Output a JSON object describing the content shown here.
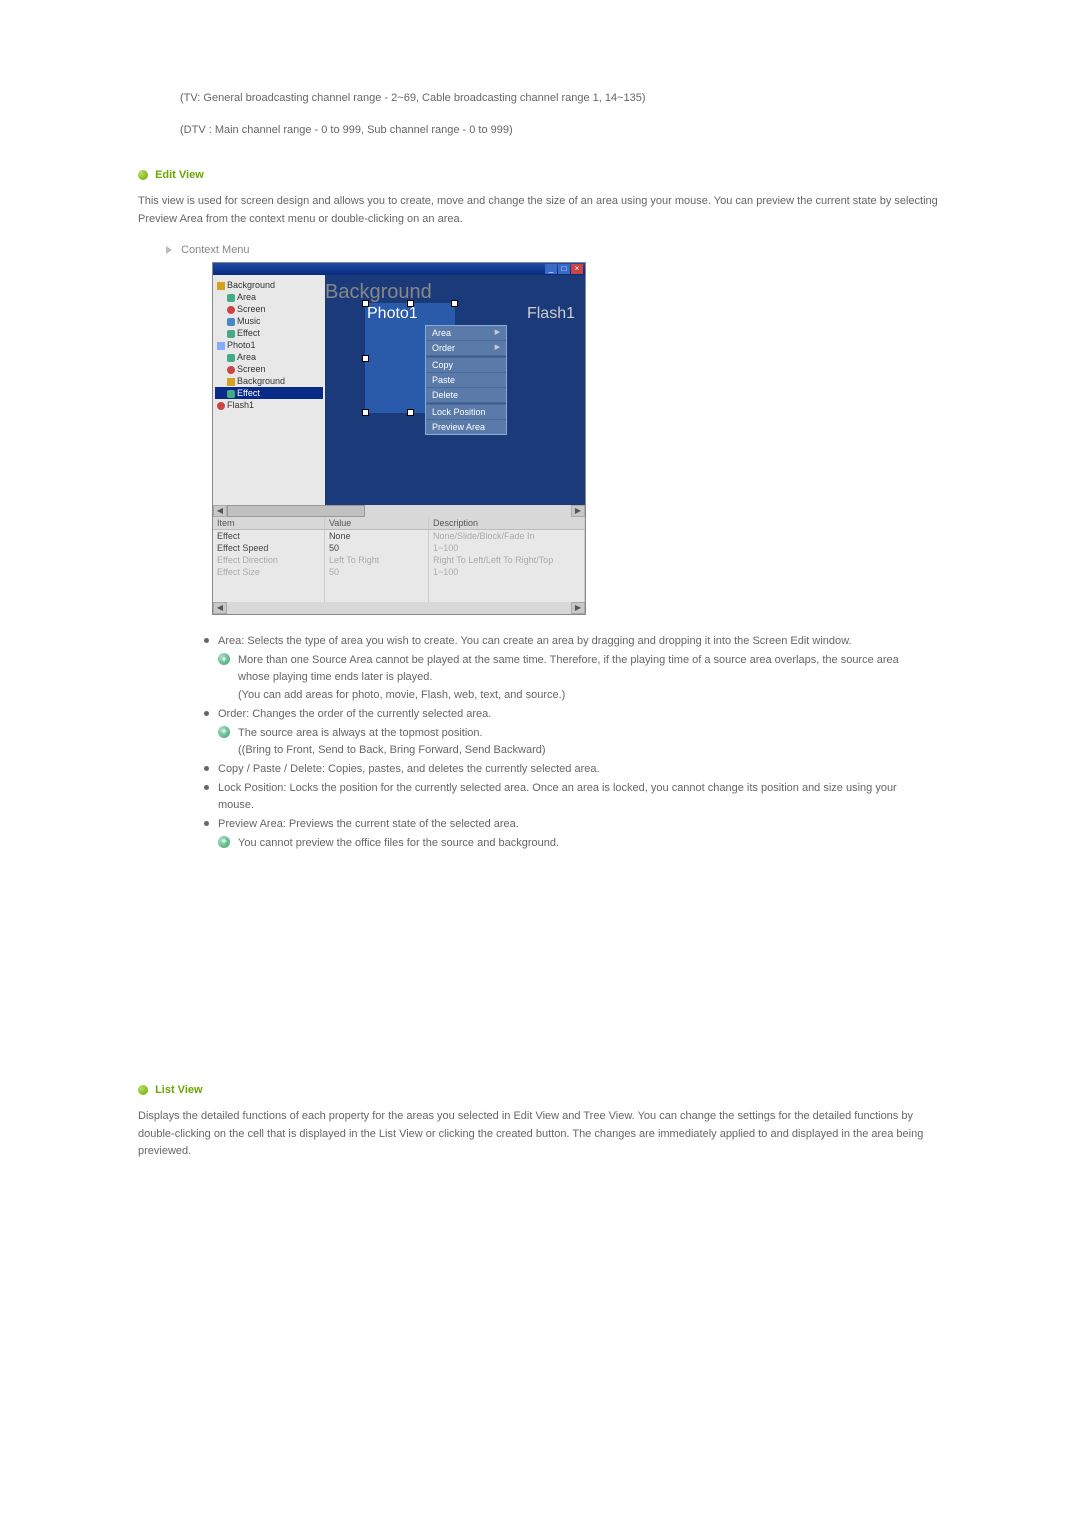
{
  "intro": {
    "line1": "(TV: General broadcasting channel range - 2~69, Cable broadcasting channel range 1, 14~135)",
    "line2": "(DTV : Main channel range - 0 to 999, Sub channel range - 0 to 999)"
  },
  "editView": {
    "title": "Edit View",
    "body": "This view is used for screen design and allows you to create, move and change the size of an area using your mouse. You can preview the current state by selecting Preview Area from the context menu or double-clicking on an area.",
    "contextMenuLabel": "Context Menu"
  },
  "screenshot": {
    "tree": [
      "Background",
      "Area",
      "Screen",
      "Music",
      "Effect",
      "Photo1",
      "Area",
      "Screen",
      "Background",
      "Effect",
      "Flash1"
    ],
    "canvas": {
      "bgText": "Background",
      "photoLabel": "Photo1",
      "flashLabel": "Flash1"
    },
    "contextMenu": {
      "area": "Area",
      "order": "Order",
      "copy": "Copy",
      "paste": "Paste",
      "delete": "Delete",
      "lock": "Lock Position",
      "preview": "Preview Area"
    },
    "table": {
      "headers": {
        "item": "Item",
        "value": "Value",
        "desc": "Description"
      },
      "rows": [
        {
          "item": "Effect",
          "value": "None",
          "desc": "None/Slide/Block/Fade In"
        },
        {
          "item": "Effect Speed",
          "value": "50",
          "desc": "1~100"
        },
        {
          "item": "Effect Direction",
          "value": "Left To Right",
          "desc": "Right To Left/Left To Right/Top"
        },
        {
          "item": "Effect Size",
          "value": "50",
          "desc": "1~100"
        }
      ]
    }
  },
  "details": {
    "area": {
      "label": "Area: Selects the type of area you wish to create. You can create an area by dragging and dropping it into the Screen Edit window.",
      "note1": "More than one Source Area cannot be played at the same time. Therefore, if the playing time of a source area overlaps, the source area whose playing time ends later is played.",
      "note1b": "(You can add areas for photo, movie, Flash, web, text, and source.)"
    },
    "order": {
      "label": "Order: Changes the order of the currently selected area.",
      "note1": "The source area is always at the topmost position.",
      "note1b": "((Bring to Front, Send to Back, Bring Forward, Send Backward)"
    },
    "copy": {
      "label": "Copy / Paste / Delete: Copies, pastes, and deletes the currently selected area."
    },
    "lock": {
      "label": "Lock Position: Locks the position for the currently selected area. Once an area is locked, you cannot change its position and size using your mouse."
    },
    "preview": {
      "label": "Preview Area: Previews the current state of the selected area.",
      "note1": "You cannot preview the office files for the source and background."
    }
  },
  "listView": {
    "title": "List View",
    "body": "Displays the detailed functions of each property for the areas you selected in Edit View and Tree View. You can change the settings for the detailed functions by double-clicking on the cell that is displayed in the List View or clicking the created button. The changes are immediately applied to and displayed in the area being previewed."
  }
}
